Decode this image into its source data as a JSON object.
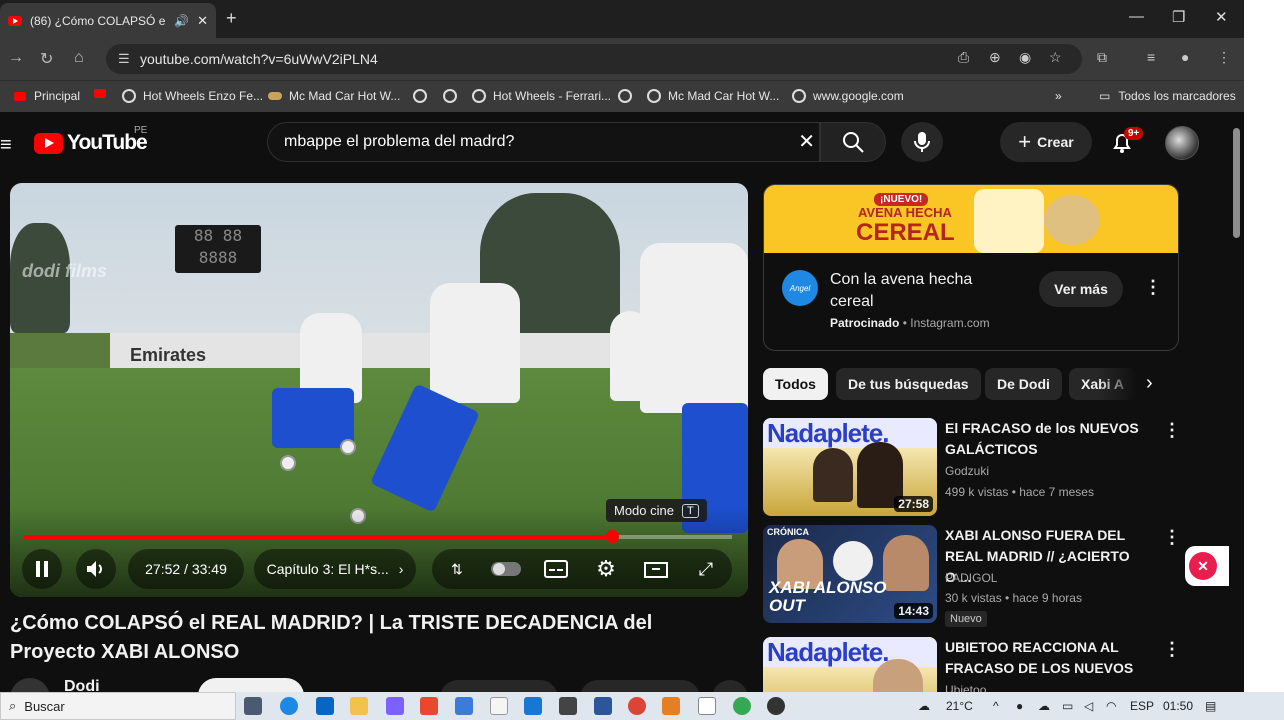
{
  "browser": {
    "tab_title": "(86) ¿Cómo COLAPSÓ el RE",
    "url": "youtube.com/watch?v=6uWwV2iPLN4",
    "bookmarks": [
      "Principal",
      "Hot Wheels Enzo Fe...",
      "Mc Mad Car Hot W...",
      "Hot Wheels - Ferrari...",
      "Mc Mad Car Hot W...",
      "www.google.com"
    ],
    "all_bookmarks": "Todos los marcadores"
  },
  "youtube": {
    "logo": "YouTube",
    "country": "PE",
    "search_query": "mbappe el problema del madrd?",
    "create_label": "Crear",
    "notif_count": "9+"
  },
  "player": {
    "time": "27:52 / 33:49",
    "chapter": "Capítulo 3: El H*s...",
    "tooltip": "Modo cine",
    "tooltip_key": "T",
    "progress": 0.83,
    "watermark": "dodi films",
    "board_top": "88 88",
    "board_bottom": "8888",
    "fence_text": "Emirates"
  },
  "video": {
    "title": "¿Cómo COLAPSÓ el REAL MADRID? | La TRISTE DECADENCIA del Proyecto XABI ALONSO",
    "channel": "Dodi"
  },
  "ad": {
    "badge": "¡NUEVO!",
    "headline1": "AVENA HECHA",
    "headline2": "CEREAL",
    "logo": "Angel",
    "title": "Con la avena hecha cereal",
    "sponsored": "Patrocinado",
    "domain": "Instagram.com",
    "cta": "Ver más"
  },
  "chips": [
    "Todos",
    "De tus búsquedas",
    "De Dodi",
    "Xabi A"
  ],
  "recommendations": [
    {
      "title": "El FRACASO de los NUEVOS GALÁCTICOS",
      "channel": "Godzuki",
      "meta": "499 k vistas • hace 7 meses",
      "duration": "27:58",
      "thumb_text": "Nadaplete."
    },
    {
      "title": "XABI ALONSO FUERA DEL REAL MADRID // ¿ACIERTO O ...",
      "channel": "PADIGOL",
      "meta": "30 k vistas • hace 9 horas",
      "duration": "14:43",
      "badge": "Nuevo",
      "thumb_text": "XABI ALONSO OUT",
      "thumb_small": "CRÓNICA"
    },
    {
      "title": "UBIETOO REACCIONA AL FRACASO DE LOS NUEVOS ...",
      "channel": "Ubietoo",
      "thumb_text": "Nadaplete."
    }
  ],
  "taskbar": {
    "search": "Buscar",
    "weather": "21°C",
    "lang": "ESP",
    "time": "01:50"
  }
}
